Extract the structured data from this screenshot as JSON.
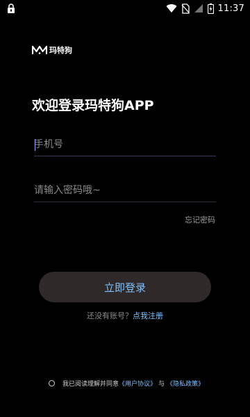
{
  "status_bar": {
    "time": "11:37",
    "icons": [
      "lock-icon",
      "wifi-icon",
      "no-sim-icon",
      "signal-icon",
      "battery-charging-icon"
    ]
  },
  "brand": {
    "logo_icon": "m-logo-icon",
    "name": "玛特狗"
  },
  "welcome_title": "欢迎登录玛特狗APP",
  "phone_field": {
    "placeholder": "手机号",
    "value": ""
  },
  "password_field": {
    "placeholder": "请输入密码哦~",
    "value": ""
  },
  "forgot_password": "忘记密码",
  "login_button": "立即登录",
  "register": {
    "prompt": "还没有账号？",
    "link": "点我注册"
  },
  "agreement": {
    "text": "我已阅读理解并同意",
    "user_agreement": "《用户协议》",
    "and": "与",
    "privacy_policy": "《隐私政策》",
    "checked": false
  },
  "colors": {
    "background": "#000000",
    "accent": "#7fc0ff",
    "button_bg": "#2f2929",
    "muted_text": "#8a8a8a"
  }
}
